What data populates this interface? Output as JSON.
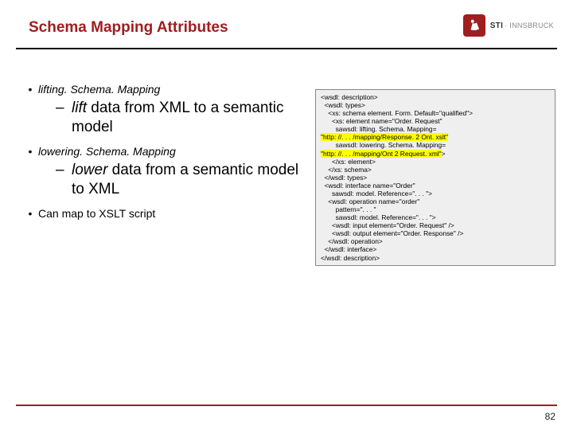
{
  "title": "Schema Mapping Attributes",
  "logo": {
    "brand": "STI",
    "sub": "INNSBRUCK"
  },
  "bullets": {
    "b1": "lifting. Schema. Mapping",
    "s1_ital": "lift",
    "s1_rest": " data from XML to a semantic model",
    "b2": "lowering. Schema. Mapping",
    "s2_ital": "lower",
    "s2_rest": " data from a semantic model to XML",
    "b3": "Can map to XSLT script"
  },
  "code": {
    "l01": "<wsdl: description>",
    "l02": "  <wsdl: types>",
    "l03": "    <xs: schema element. Form. Default=\"qualified\">",
    "l04": "      <xs: element name=\"Order. Request\"",
    "l05a": "        sawsdl: lifting. Schema. Mapping=",
    "l05b": "\"http: //. . . /mapping/Response. 2 Ont. xslt\"",
    "l06a": "        sawsdl: lowering. Schema. Mapping=",
    "l06b": "\"http: //. . . /mapping/Ont 2 Request. xml\"",
    "l06c": ">",
    "l07": "      </xs: element>",
    "l08": "    </xs: schema>",
    "l09": "  </wsdl: types>",
    "l10": "  <wsdl: interface name=\"Order\"",
    "l11": "      sawsdl: model. Reference=\". . . \">",
    "l12": "    <wsdl: operation name=\"order\"",
    "l13": "        pattern=\". . . \"",
    "l14": "        sawsdl: model. Reference=\". . . \">",
    "l15": "      <wsdl: input element=\"Order. Request\" />",
    "l16": "      <wsdl: output element=\"Order. Response\" />",
    "l17": "    </wsdl: operation>",
    "l18": "  </wsdl: interface>",
    "l19": "</wsdl: description>"
  },
  "page": "82"
}
